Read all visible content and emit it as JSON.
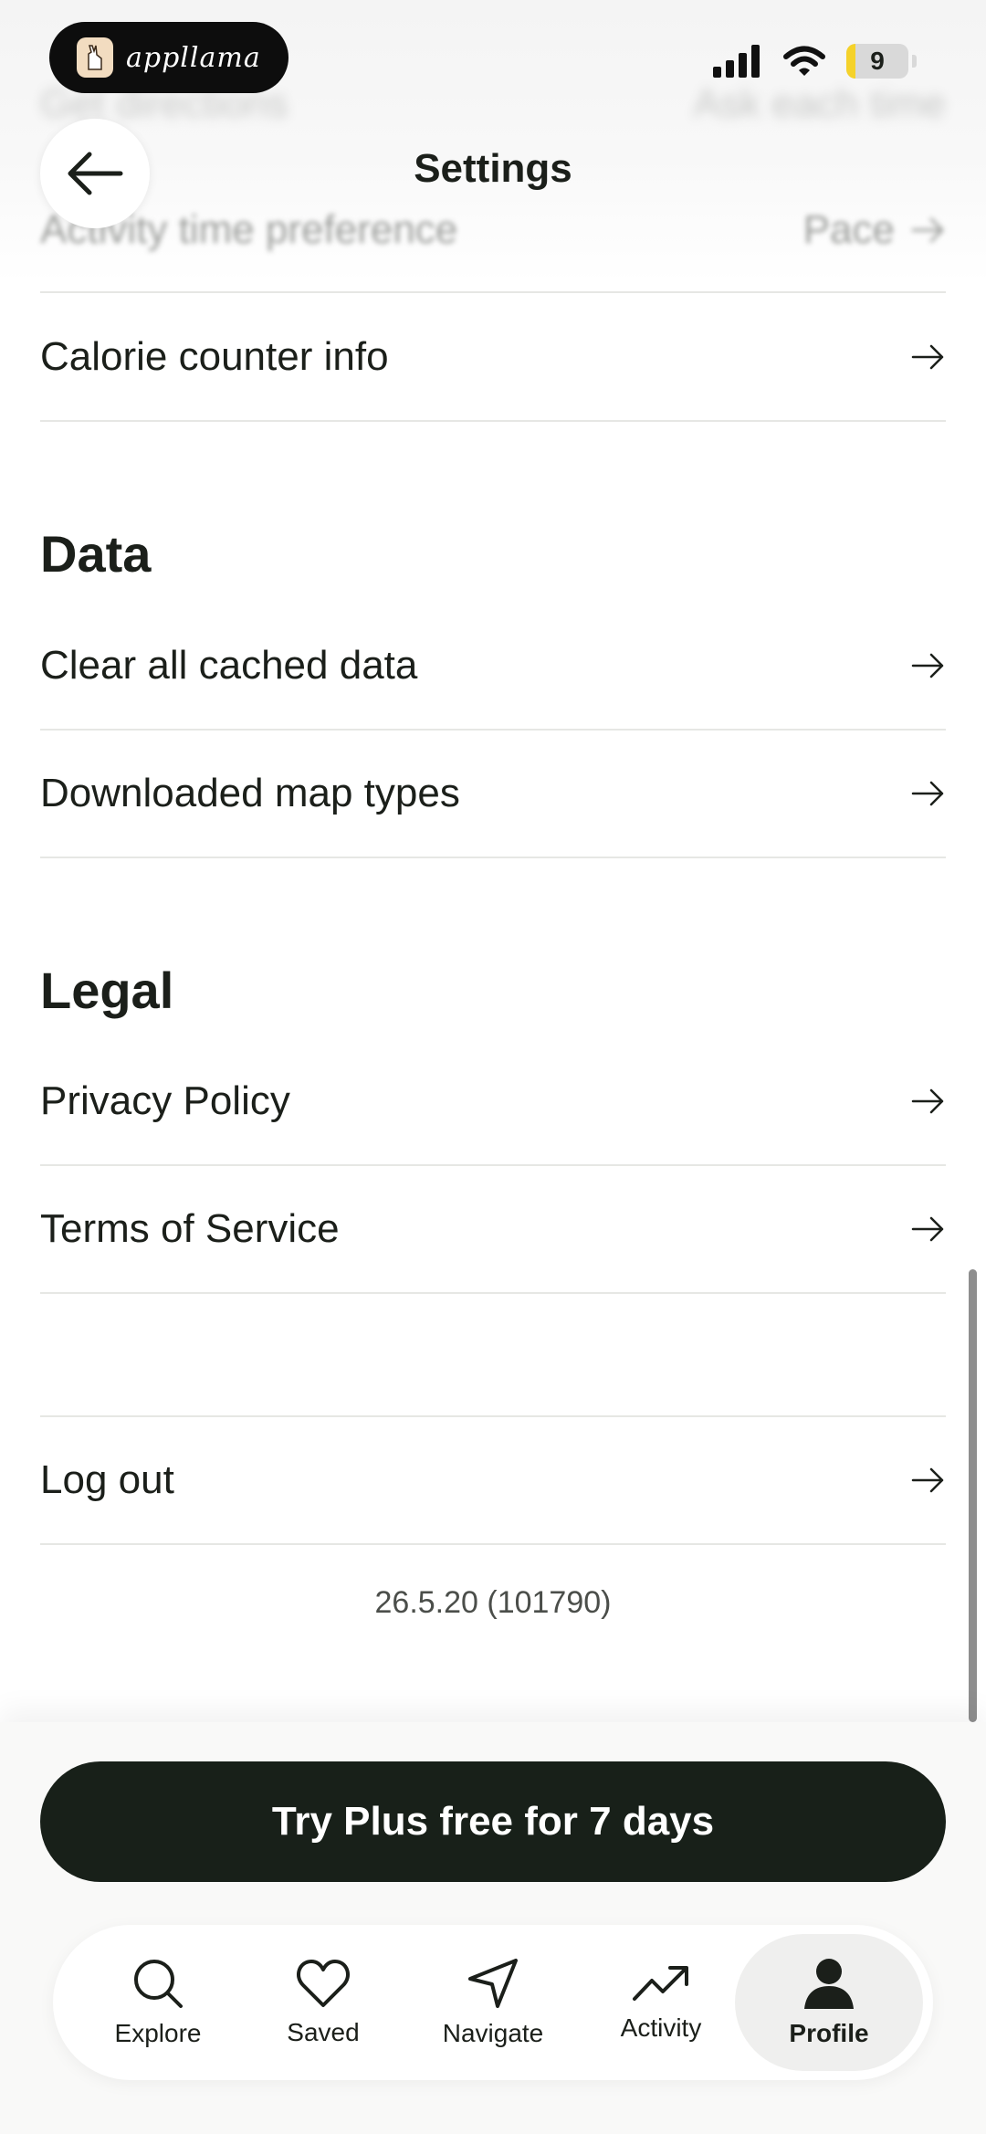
{
  "status_bar": {
    "app_badge": "appllama",
    "battery_level": "9"
  },
  "background_rows": {
    "top": {
      "label": "Get directions",
      "value": "Ask each time"
    },
    "activity_time": {
      "label": "Activity time preference",
      "value": "Pace"
    }
  },
  "header": {
    "title": "Settings"
  },
  "rows": {
    "calorie": "Calorie counter info",
    "clear_cache": "Clear all cached data",
    "map_types": "Downloaded map types",
    "privacy": "Privacy Policy",
    "terms": "Terms of Service",
    "logout": "Log out"
  },
  "sections": {
    "data": "Data",
    "legal": "Legal"
  },
  "version": "26.5.20 (101790)",
  "cta": {
    "label": "Try Plus free for 7 days"
  },
  "nav": {
    "explore": "Explore",
    "saved": "Saved",
    "navigate": "Navigate",
    "activity": "Activity",
    "profile": "Profile",
    "active": "Profile"
  },
  "colors": {
    "primary_dark": "#182019",
    "battery_fill": "#f5d22a",
    "divider": "#e6e7e4"
  }
}
